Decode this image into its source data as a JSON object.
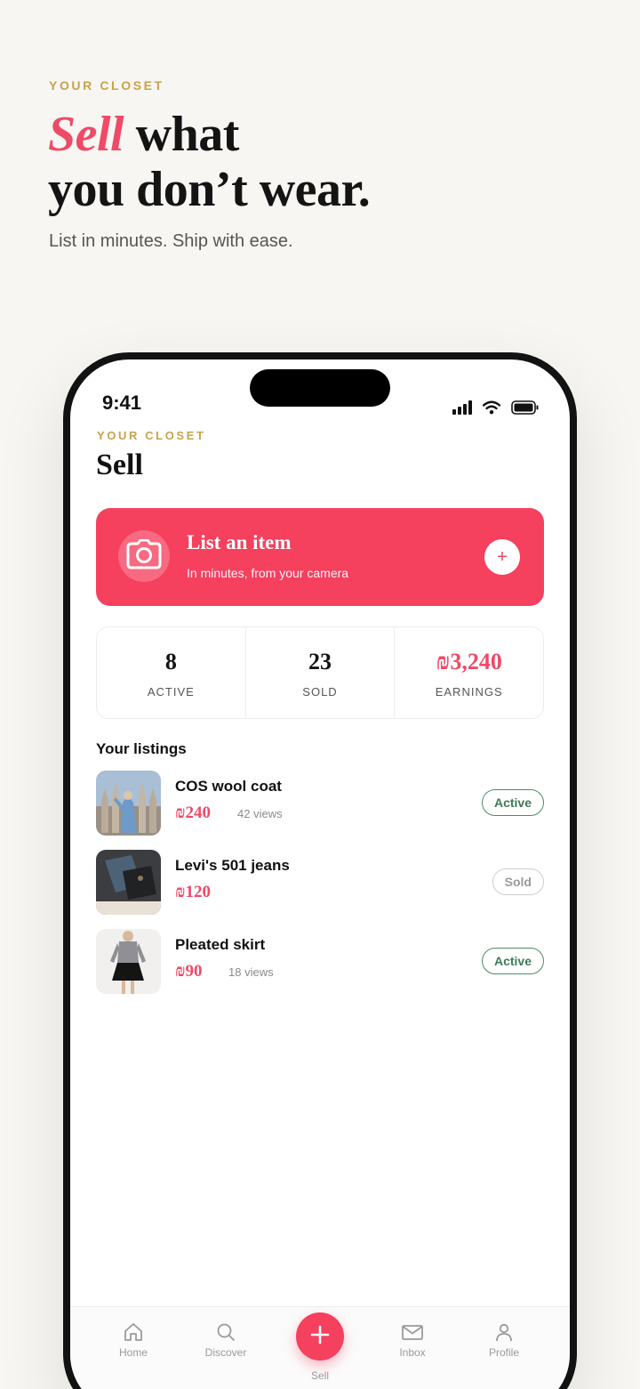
{
  "hero": {
    "eyebrow": "YOUR CLOSET",
    "title_accent": "Sell",
    "title_line1_rest": " what",
    "title_line2": "you don’t wear.",
    "subtitle": "List in minutes. Ship with ease."
  },
  "status_bar": {
    "time": "9:41"
  },
  "app": {
    "eyebrow": "YOUR CLOSET",
    "title": "Sell"
  },
  "cta": {
    "title": "List an item",
    "subtitle": "In minutes, from your camera",
    "plus": "+"
  },
  "stats": [
    {
      "value": "8",
      "label": "ACTIVE"
    },
    {
      "value": "23",
      "label": "SOLD"
    },
    {
      "value": "₪3,240",
      "label": "EARNINGS"
    }
  ],
  "listings": {
    "title": "Your listings",
    "items": [
      {
        "name": "COS wool coat",
        "price": "₪240",
        "views": "42 views",
        "status": "Active"
      },
      {
        "name": "Levi's 501 jeans",
        "price": "₪120",
        "views": "",
        "status": "Sold"
      },
      {
        "name": "Pleated skirt",
        "price": "₪90",
        "views": "18 views",
        "status": "Active"
      }
    ]
  },
  "tabs": [
    {
      "label": "Home",
      "icon": "home-icon"
    },
    {
      "label": "Discover",
      "icon": "search-icon"
    },
    {
      "label": "Sell",
      "icon": "plus-icon"
    },
    {
      "label": "Inbox",
      "icon": "mail-icon"
    },
    {
      "label": "Profile",
      "icon": "user-icon"
    }
  ],
  "colors": {
    "accent": "#f5405e",
    "gold": "#c9a24b",
    "active_badge": "#3f7a57",
    "background": "#f7f6f2"
  }
}
